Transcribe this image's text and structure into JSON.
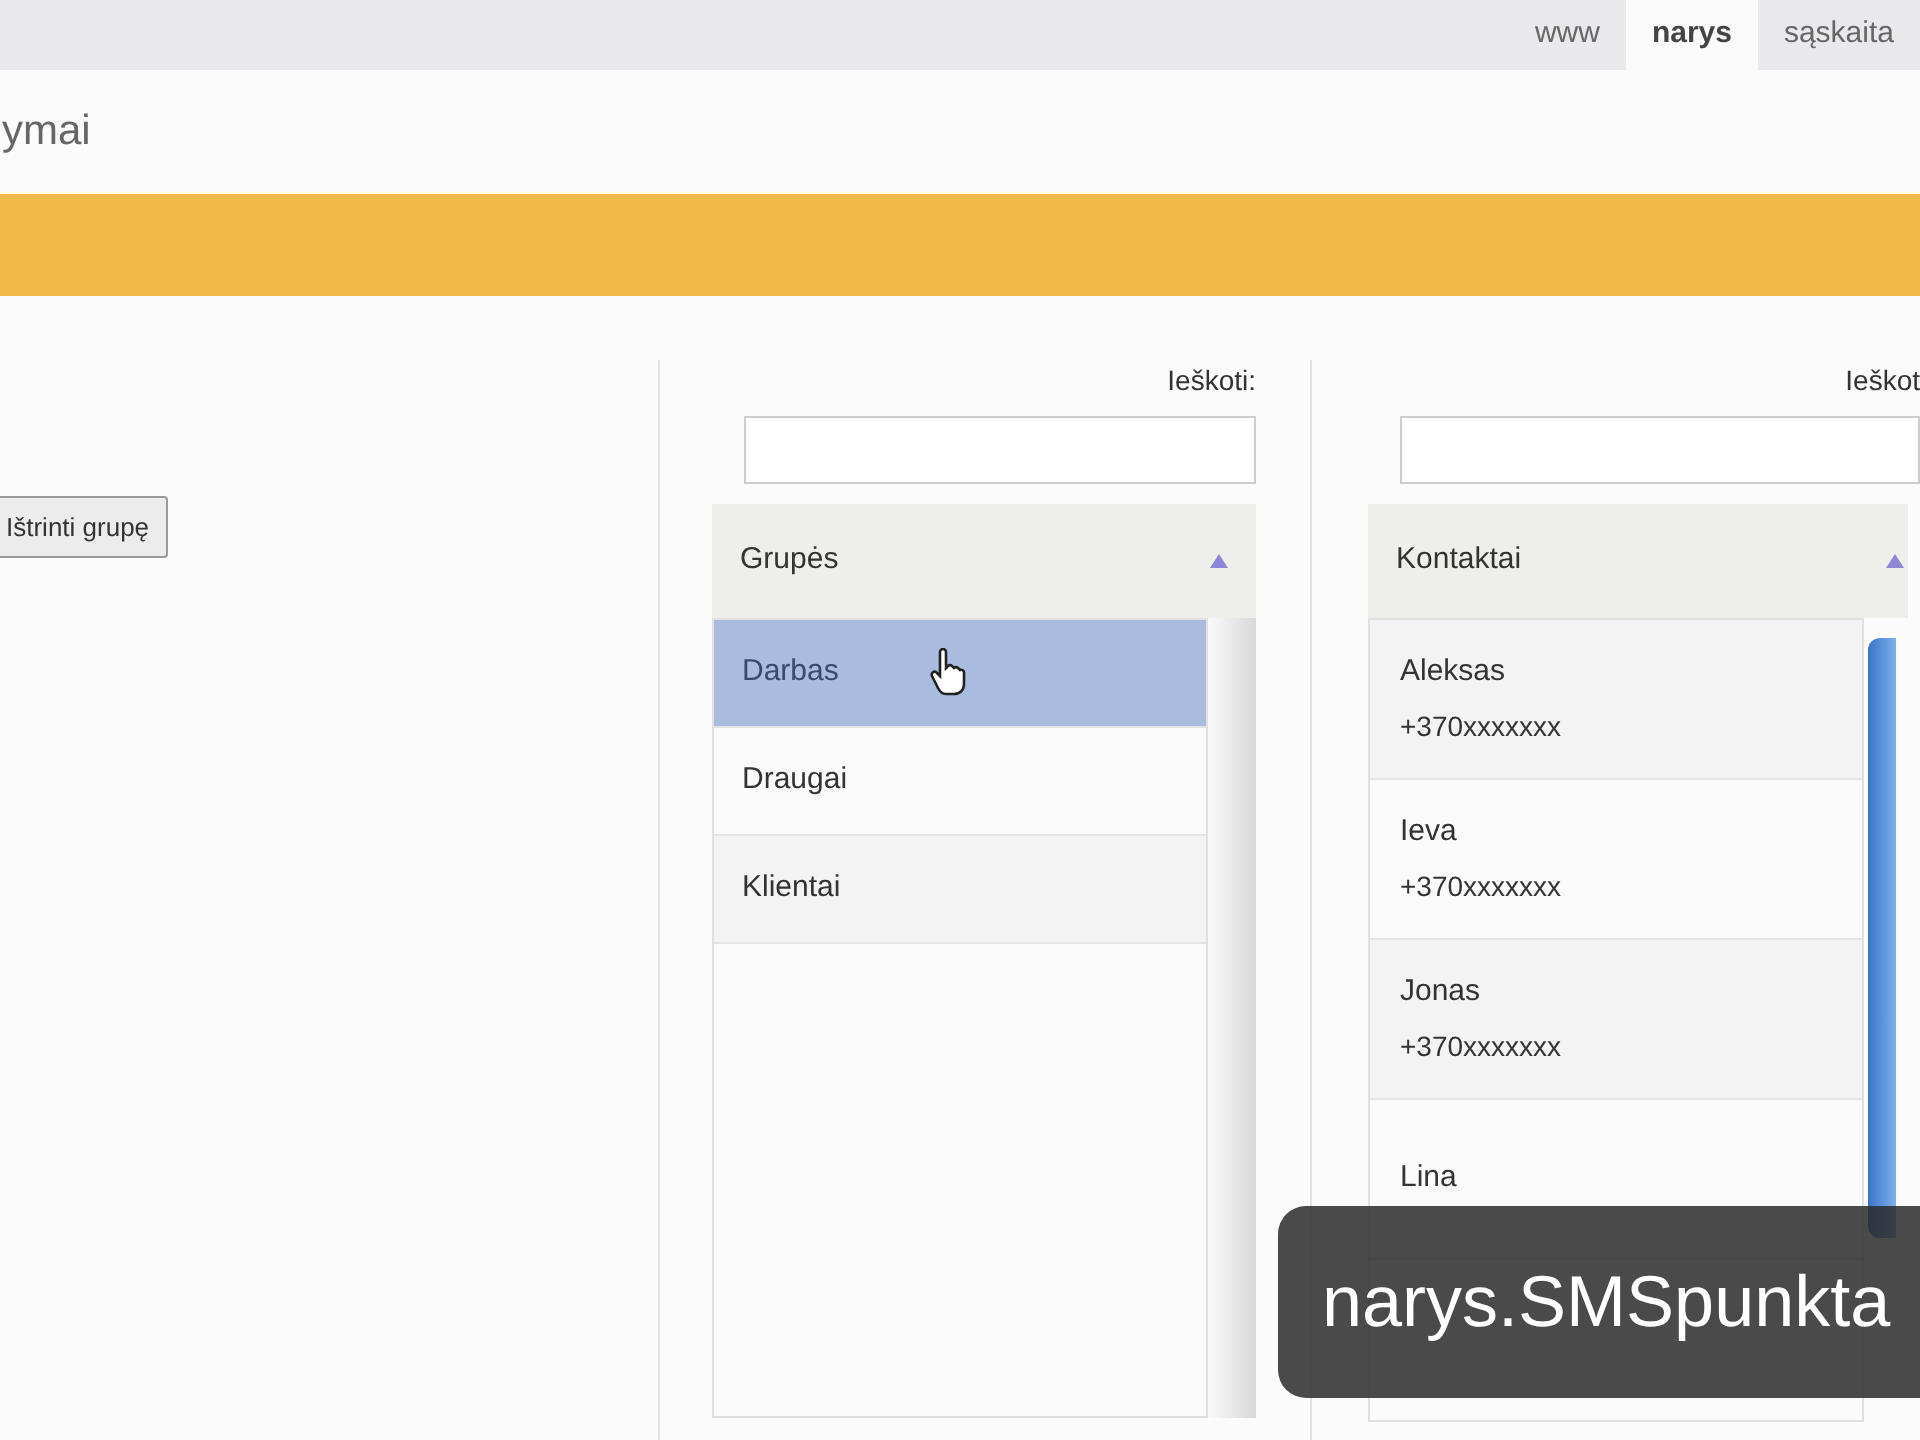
{
  "top_tabs": [
    {
      "label": "www",
      "selected": false
    },
    {
      "label": "narys",
      "selected": true
    },
    {
      "label": "sąskaita",
      "selected": false
    }
  ],
  "page_title": "ymai",
  "delete_group_button": "Ištrinti grupę",
  "groups_panel": {
    "search_label": "Ieškoti:",
    "header": "Grupės",
    "items": [
      {
        "label": "Darbas",
        "selected": true
      },
      {
        "label": "Draugai",
        "selected": false
      },
      {
        "label": "Klientai",
        "selected": false
      }
    ]
  },
  "contacts_panel": {
    "search_label": "Ieškot",
    "header": "Kontaktai",
    "items": [
      {
        "name": "Aleksas",
        "phone": "+370xxxxxxx"
      },
      {
        "name": "Ieva",
        "phone": "+370xxxxxxx"
      },
      {
        "name": "Jonas",
        "phone": "+370xxxxxxx"
      },
      {
        "name": "Lina"
      }
    ]
  },
  "caption": "narys.SMSpunkta"
}
